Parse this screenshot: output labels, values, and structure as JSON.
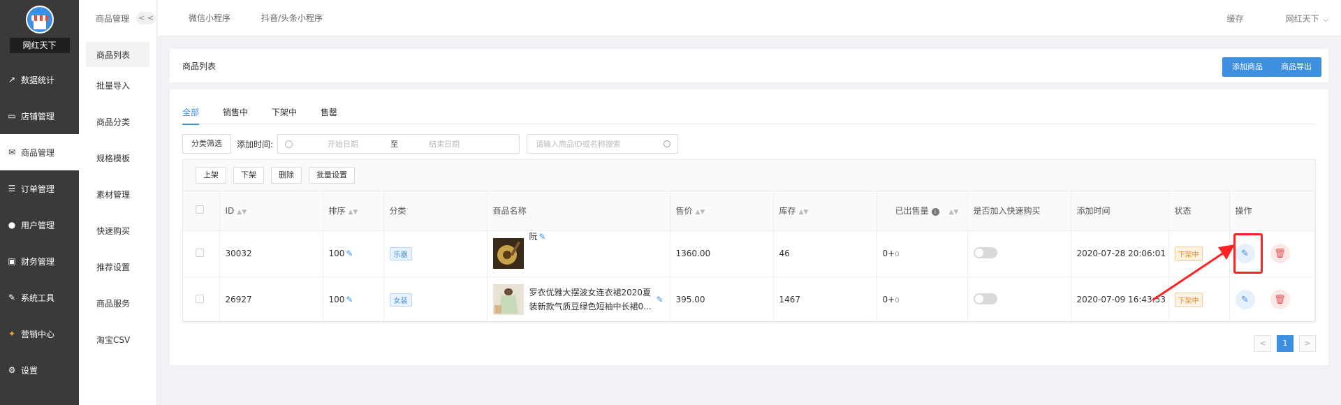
{
  "sidebar": {
    "brand": "网红天下",
    "items": [
      {
        "label": "数据统计",
        "icon": "chart-line-icon"
      },
      {
        "label": "店铺管理",
        "icon": "store-icon"
      },
      {
        "label": "商品管理",
        "icon": "goods-icon"
      },
      {
        "label": "订单管理",
        "icon": "order-icon"
      },
      {
        "label": "用户管理",
        "icon": "user-icon"
      },
      {
        "label": "财务管理",
        "icon": "finance-icon"
      },
      {
        "label": "系统工具",
        "icon": "wrench-icon"
      },
      {
        "label": "营销中心",
        "icon": "marketing-icon"
      },
      {
        "label": "设置",
        "icon": "gear-icon"
      }
    ]
  },
  "subnav": {
    "title": "商品管理",
    "collapse": "< <",
    "items": [
      "商品列表",
      "批量导入",
      "商品分类",
      "规格模板",
      "素材管理",
      "快速购买",
      "推荐设置",
      "商品服务",
      "淘宝CSV"
    ]
  },
  "topbar": {
    "tabs": [
      "微信小程序",
      "抖音/头条小程序"
    ],
    "cache": "缓存",
    "user": "网红天下",
    "user_caret": "⌵"
  },
  "header": {
    "title": "商品列表",
    "add_btn": "添加商品",
    "export_btn": "商品导出"
  },
  "tabs": [
    "全部",
    "销售中",
    "下架中",
    "售罄"
  ],
  "filters": {
    "category_btn": "分类筛选",
    "time_label": "添加时间:",
    "start_placeholder": "开始日期",
    "to": "至",
    "end_placeholder": "结束日期",
    "search_placeholder": "请输入商品ID或名称搜索"
  },
  "actions": [
    "上架",
    "下架",
    "删除",
    "批量设置"
  ],
  "table": {
    "headers": [
      "ID",
      "排序",
      "分类",
      "商品名称",
      "售价",
      "库存",
      "已出售量",
      "是否加入快速购买",
      "添加时间",
      "状态",
      "操作"
    ],
    "rows": [
      {
        "id": "30032",
        "sort": "100",
        "category": "乐器",
        "name": "阮",
        "price": "1360.00",
        "stock": "46",
        "sold": "0+",
        "sold_extra": "0",
        "time": "2020-07-28 20:06:01",
        "status": "下架中"
      },
      {
        "id": "26927",
        "sort": "100",
        "category": "女装",
        "name": "罗衣优雅大摆波女连衣裙2020夏装新款气质豆绿色短袖中长裙0...",
        "price": "395.00",
        "stock": "1467",
        "sold": "0+",
        "sold_extra": "0",
        "time": "2020-07-09 16:43:53",
        "status": "下架中"
      }
    ]
  },
  "pager": {
    "prev": "<",
    "current": "1",
    "next": ">"
  },
  "colors": {
    "primary": "#3d8fe0",
    "sidebar": "#3a3a3a",
    "annotation": "#ff2222"
  }
}
